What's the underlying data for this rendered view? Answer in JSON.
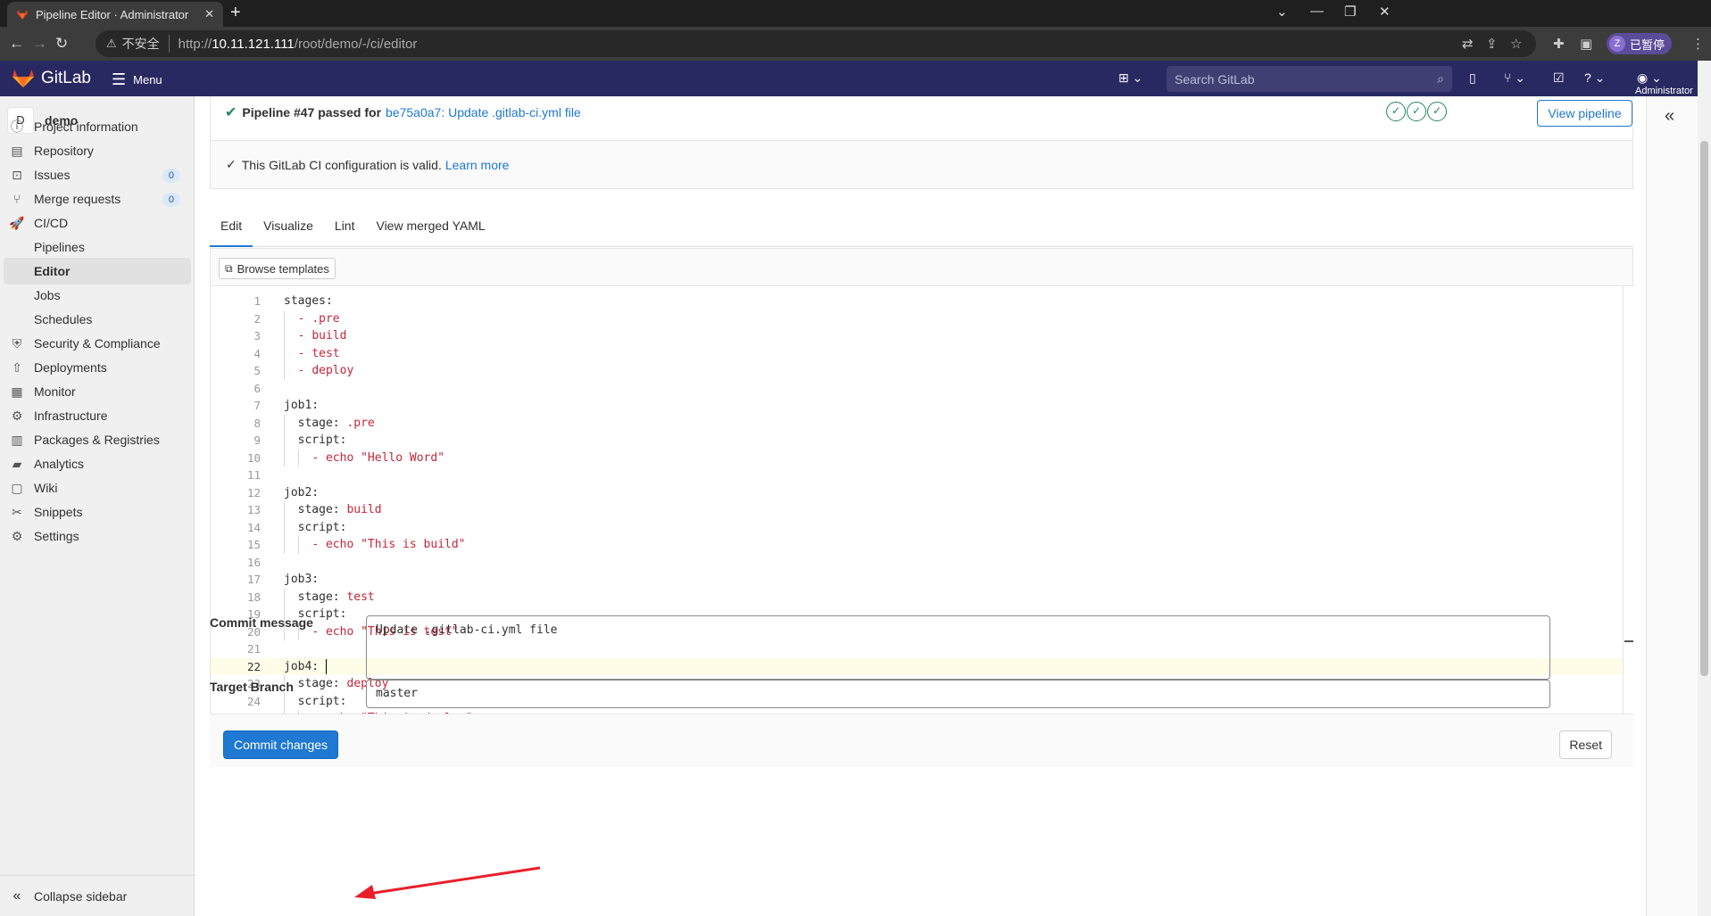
{
  "browser": {
    "tab_title": "Pipeline Editor · Administrator",
    "tab_close": "✕",
    "new_tab": "+",
    "insecure_label": "不安全",
    "url_prefix": "http://",
    "url_host": "10.11.121.111",
    "url_path": "/root/demo/-/ci/editor",
    "profile_initial": "Z",
    "profile_status": "已暂停"
  },
  "header": {
    "brand": "GitLab",
    "menu_label": "Menu",
    "search_placeholder": "Search GitLab",
    "user_label": "Administrator"
  },
  "sidebar": {
    "project_initial": "D",
    "project_name": "demo",
    "items": [
      {
        "label": "Project information"
      },
      {
        "label": "Repository"
      },
      {
        "label": "Issues",
        "count": "0"
      },
      {
        "label": "Merge requests",
        "count": "0"
      },
      {
        "label": "CI/CD"
      },
      {
        "label": "Security & Compliance"
      },
      {
        "label": "Deployments"
      },
      {
        "label": "Monitor"
      },
      {
        "label": "Infrastructure"
      },
      {
        "label": "Packages & Registries"
      },
      {
        "label": "Analytics"
      },
      {
        "label": "Wiki"
      },
      {
        "label": "Snippets"
      },
      {
        "label": "Settings"
      }
    ],
    "cicd_sub": [
      {
        "label": "Pipelines"
      },
      {
        "label": "Editor"
      },
      {
        "label": "Jobs"
      },
      {
        "label": "Schedules"
      }
    ],
    "collapse_label": "Collapse sidebar"
  },
  "pipeline": {
    "status_label": "Pipeline #47 passed for",
    "commit_link": "be75a0a7: Update .gitlab-ci.yml file",
    "view_button": "View pipeline",
    "valid_text": "This GitLab CI configuration is valid.",
    "learn_more": "Learn more"
  },
  "tabs": [
    "Edit",
    "Visualize",
    "Lint",
    "View merged YAML"
  ],
  "editor": {
    "browse_templates": "Browse templates",
    "current_line": 22,
    "lines": [
      "stages:",
      "  - .pre",
      "  - build",
      "  - test",
      "  - deploy",
      "",
      "job1:",
      "  stage: .pre",
      "  script:",
      "    - echo \"Hello Word\"",
      "",
      "job2:",
      "  stage: build",
      "  script:",
      "    - echo \"This is build\"",
      "",
      "job3:",
      "  stage: test",
      "  script:",
      "    - echo \"This is test\"",
      "",
      "job4: ",
      "  stage: deploy",
      "  script:",
      "    - echo \"This is deploy\""
    ]
  },
  "form": {
    "commit_message_label": "Commit message",
    "commit_message_value": "Update .gitlab-ci.yml file",
    "target_branch_label": "Target Branch",
    "target_branch_value": "master",
    "commit_button": "Commit changes",
    "reset_button": "Reset"
  },
  "colors": {
    "header_bg": "#292961",
    "link": "#1f78d1",
    "success": "#1f8a5c",
    "yaml_value": "#c4273b",
    "annotation_arrow": "#e8202a"
  }
}
